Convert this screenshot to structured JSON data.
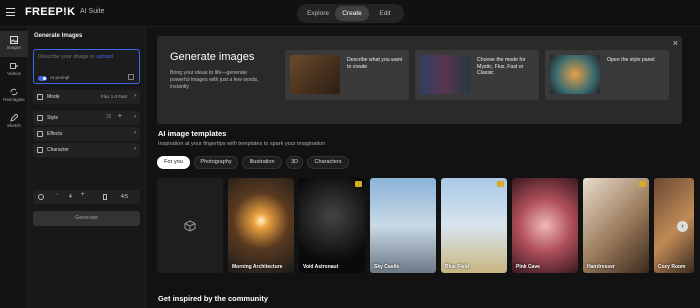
{
  "app": {
    "logo": "FREEP!K",
    "suite": "AI Suite"
  },
  "mode_tabs": [
    "Explore",
    "Create",
    "Edit"
  ],
  "rail": [
    "Images",
    "Videos",
    "Reimagine",
    "Sketch"
  ],
  "panel": {
    "title": "Generate Images",
    "prompt_placeholder": "Describe your image or ",
    "prompt_link": "upload",
    "ai_prompt_label": "AI prompt",
    "mode_label": "Mode",
    "mode_value": "Flux 1.0 Fast",
    "style_label": "Style",
    "effects_label": "Effects",
    "character_label": "Character",
    "count_value": "4",
    "ratio_value": "4:5",
    "generate_label": "Generate"
  },
  "hero": {
    "title": "Generate images",
    "desc": "Bring your ideas to life—generate powerful images with just a few words, instantly",
    "cards": [
      {
        "text": "Describe what you want to create"
      },
      {
        "text": "Choose the mode for Mystic, Flux, Fast or Classic"
      },
      {
        "text": "Open the style panel"
      }
    ],
    "close": "×"
  },
  "templates": {
    "title": "AI image templates",
    "subtitle": "Inspiration at your fingertips with templates to spark your imagination",
    "chips": [
      "For you",
      "Photography",
      "Illustration",
      "3D",
      "Characters"
    ],
    "tiles": [
      "",
      "Morning Architecture",
      "Void Astronaut",
      "Sky Castle",
      "Blue Field",
      "Pink Cave",
      "Hairdresser",
      "Cozy Room"
    ]
  },
  "community": {
    "title": "Get inspired by the community"
  },
  "colors": {
    "accent": "#3d69e8",
    "premium": "#d9a92c"
  }
}
